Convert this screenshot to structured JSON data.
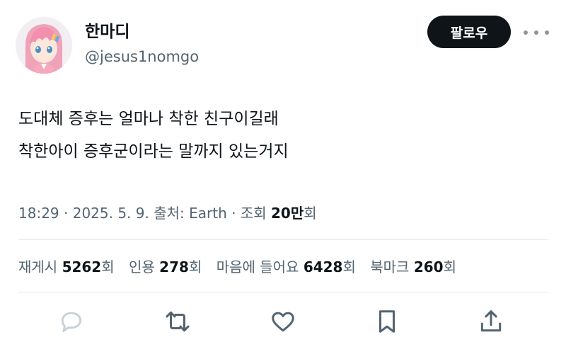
{
  "user": {
    "display_name": "한마디",
    "handle": "@jesus1nomgo"
  },
  "header": {
    "follow_label": "팔로우",
    "more_icon": "more-horizontal-icon"
  },
  "tweet": {
    "lines": [
      "도대체 증후는 얼마나 착한 친구이길래",
      "착한아이 증후군이라는 말까지 있는거지"
    ]
  },
  "meta": {
    "time": "18:29",
    "sep1": " · ",
    "date": "2025. 5. 9.",
    "source_label": " 출처: ",
    "source": "Earth",
    "sep2": " · ",
    "views_label": "조회 ",
    "views_value": "20만",
    "views_suffix": "회"
  },
  "stats": {
    "retweets": {
      "label": "재게시 ",
      "value": "5262",
      "suffix": "회"
    },
    "quotes": {
      "label": "인용 ",
      "value": "278",
      "suffix": "회"
    },
    "likes": {
      "label": "마음에 들어요 ",
      "value": "6428",
      "suffix": "회"
    },
    "bookmarks": {
      "label": "북마크 ",
      "value": "260",
      "suffix": "회"
    }
  },
  "colors": {
    "text": "#0f1419",
    "secondary": "#536471",
    "divider": "#e6eaed",
    "follow_bg": "#0f1419",
    "reply_icon": "#c7d0d7",
    "action_icon": "#536471"
  },
  "actions": [
    "reply-icon",
    "retweet-icon",
    "like-icon",
    "bookmark-icon",
    "share-icon"
  ]
}
